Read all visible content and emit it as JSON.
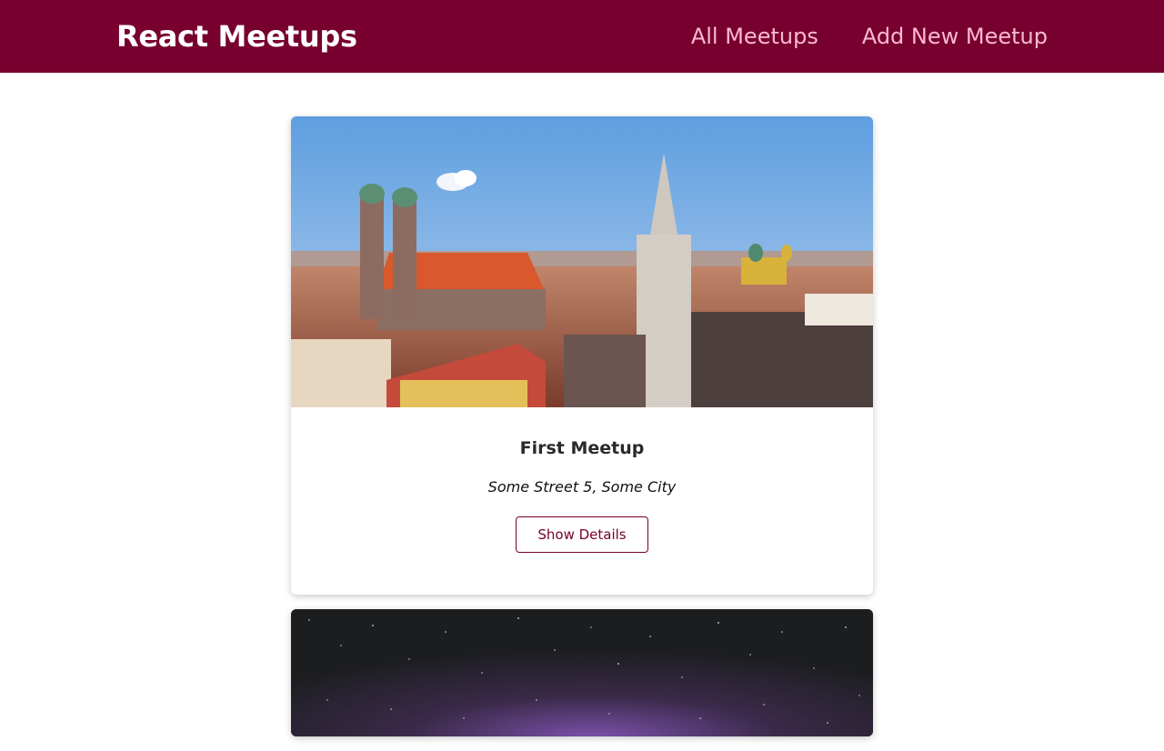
{
  "header": {
    "logo": "React Meetups",
    "nav": [
      {
        "label": "All Meetups"
      },
      {
        "label": "Add New Meetup"
      }
    ]
  },
  "meetups": [
    {
      "title": "First Meetup",
      "address": "Some Street 5, Some City",
      "action_label": "Show Details",
      "image": "munich-city-panorama"
    },
    {
      "title": "",
      "address": "",
      "action_label": "",
      "image": "night-sky-milky-way"
    }
  ],
  "colors": {
    "brand": "#77002e",
    "nav_link": "#fcb8d2",
    "card_title": "#2c292b"
  }
}
